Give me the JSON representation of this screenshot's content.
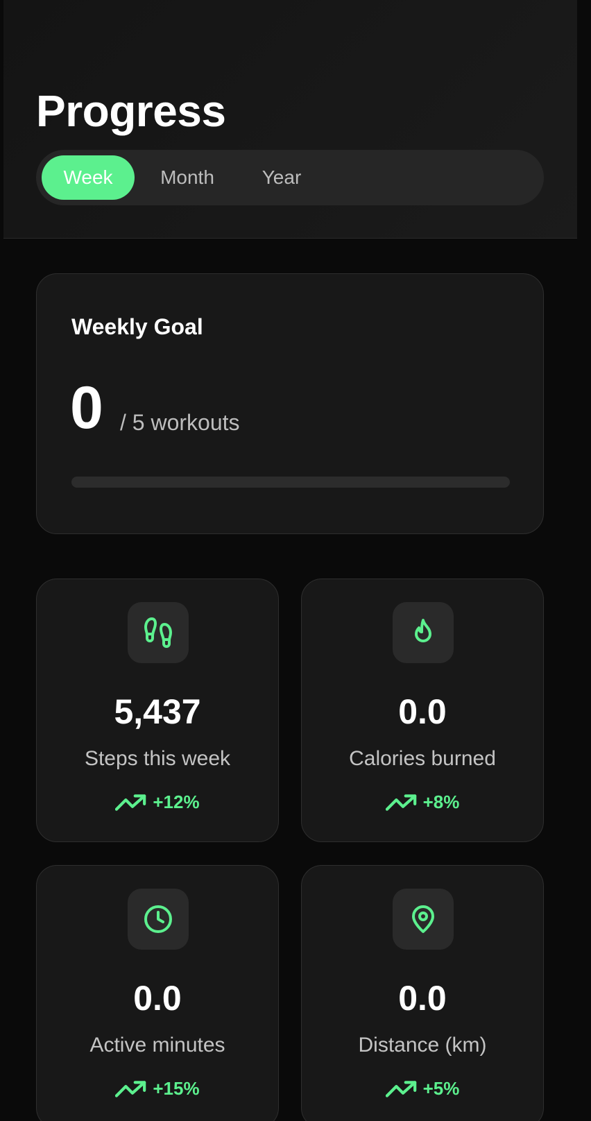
{
  "header": {
    "title": "Progress",
    "tabs": [
      {
        "label": "Week",
        "active": true
      },
      {
        "label": "Month",
        "active": false
      },
      {
        "label": "Year",
        "active": false
      }
    ]
  },
  "weekly_goal": {
    "title": "Weekly Goal",
    "count": "0",
    "target": "/ 5 workouts",
    "progress_fraction": 0
  },
  "stats": {
    "steps": {
      "icon": "footprints-icon",
      "value": "5,437",
      "label": "Steps this week",
      "trend": "+12%"
    },
    "calories": {
      "icon": "flame-icon",
      "value": "0.0",
      "label": "Calories burned",
      "trend": "+8%"
    },
    "minutes": {
      "icon": "clock-icon",
      "value": "0.0",
      "label": "Active minutes",
      "trend": "+15%"
    },
    "distance": {
      "icon": "map-pin-icon",
      "value": "0.0",
      "label": "Distance (km)",
      "trend": "+5%"
    }
  },
  "colors": {
    "accent": "#5cf08e",
    "background": "#0a0a0a",
    "card": "#181818",
    "muted_text": "#bdbdbd"
  }
}
